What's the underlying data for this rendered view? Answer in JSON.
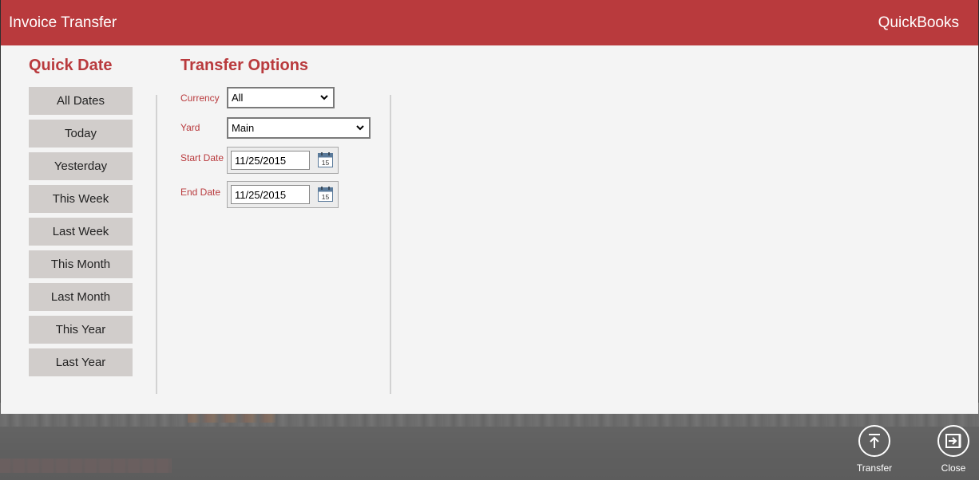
{
  "window": {
    "title": "Invoice Transfer",
    "brand": "QuickBooks"
  },
  "quick_date": {
    "heading": "Quick Date",
    "buttons": [
      "All Dates",
      "Today",
      "Yesterday",
      "This Week",
      "Last Week",
      "This Month",
      "Last Month",
      "This Year",
      "Last Year"
    ]
  },
  "transfer_options": {
    "heading": "Transfer Options",
    "currency": {
      "label": "Currency",
      "value": "All"
    },
    "yard": {
      "label": "Yard",
      "value": "Main"
    },
    "start_date": {
      "label": "Start Date",
      "value": "11/25/2015",
      "calendar_day": "15"
    },
    "end_date": {
      "label": "End Date",
      "value": "11/25/2015",
      "calendar_day": "15"
    }
  },
  "app_bar": {
    "transfer_label": "Transfer",
    "close_label": "Close"
  },
  "colors": {
    "accent": "#b93a3d",
    "panel": "#f4f4f4",
    "button": "#d1cdcb"
  }
}
